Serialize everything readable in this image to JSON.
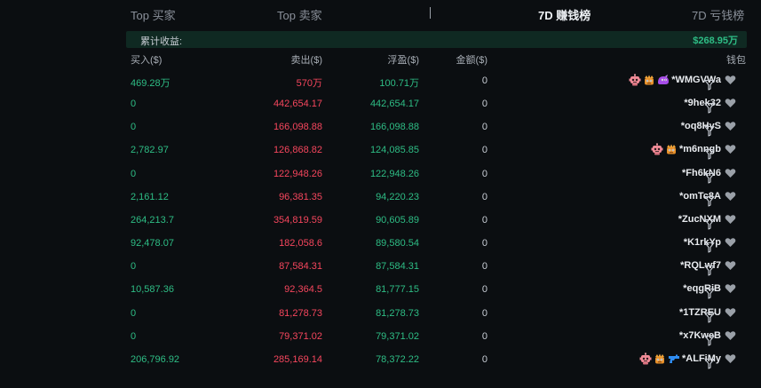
{
  "tabs": {
    "top_buyers": "Top 买家",
    "top_sellers": "Top 卖家",
    "profit_7d": "7D 赚钱榜",
    "loss_7d": "7D 亏钱榜"
  },
  "summary": {
    "label": "累计收益:",
    "value": "$268.95万"
  },
  "columns": {
    "buy": "买入($)",
    "sell": "卖出($)",
    "pnl": "浮盈($)",
    "amount": "金额($)",
    "wallet": "钱包"
  },
  "rows": [
    {
      "buy": "469.28万",
      "sell": "570万",
      "pnl": "100.71万",
      "amount": "0",
      "wallet": "*WMGVWa"
    },
    {
      "buy": "0",
      "sell": "442,654.17",
      "pnl": "442,654.17",
      "amount": "0",
      "wallet": "*9hek32"
    },
    {
      "buy": "0",
      "sell": "166,098.88",
      "pnl": "166,098.88",
      "amount": "0",
      "wallet": "*oq8HyS"
    },
    {
      "buy": "2,782.97",
      "sell": "126,868.82",
      "pnl": "124,085.85",
      "amount": "0",
      "wallet": "*m6nngb"
    },
    {
      "buy": "0",
      "sell": "122,948.26",
      "pnl": "122,948.26",
      "amount": "0",
      "wallet": "*Fh6kN6"
    },
    {
      "buy": "2,161.12",
      "sell": "96,381.35",
      "pnl": "94,220.23",
      "amount": "0",
      "wallet": "*omTc8A"
    },
    {
      "buy": "264,213.7",
      "sell": "354,819.59",
      "pnl": "90,605.89",
      "amount": "0",
      "wallet": "*ZucNXM"
    },
    {
      "buy": "92,478.07",
      "sell": "182,058.6",
      "pnl": "89,580.54",
      "amount": "0",
      "wallet": "*K1rkYp"
    },
    {
      "buy": "0",
      "sell": "87,584.31",
      "pnl": "87,584.31",
      "amount": "0",
      "wallet": "*RQLwf7"
    },
    {
      "buy": "10,587.36",
      "sell": "92,364.5",
      "pnl": "81,777.15",
      "amount": "0",
      "wallet": "*eqgRiB"
    },
    {
      "buy": "0",
      "sell": "81,278.73",
      "pnl": "81,278.73",
      "amount": "0",
      "wallet": "*1TZREU"
    },
    {
      "buy": "0",
      "sell": "79,371.02",
      "pnl": "79,371.02",
      "amount": "0",
      "wallet": "*x7KweB"
    },
    {
      "buy": "206,796.92",
      "sell": "285,169.14",
      "pnl": "78,372.22",
      "amount": "0",
      "wallet": "*ALFiMy"
    }
  ],
  "icons": {
    "bot": "bot-icon",
    "insider": "crown-monster-icon",
    "dev": "purple-blob-icon",
    "sniper": "blue-gun-icon",
    "favorite": "heart-icon",
    "filter": "filter-icon"
  },
  "colors": {
    "positive": "#2ebd85",
    "negative": "#f6465d",
    "background": "#0b0e11",
    "summary_bg": "#0f2922"
  }
}
